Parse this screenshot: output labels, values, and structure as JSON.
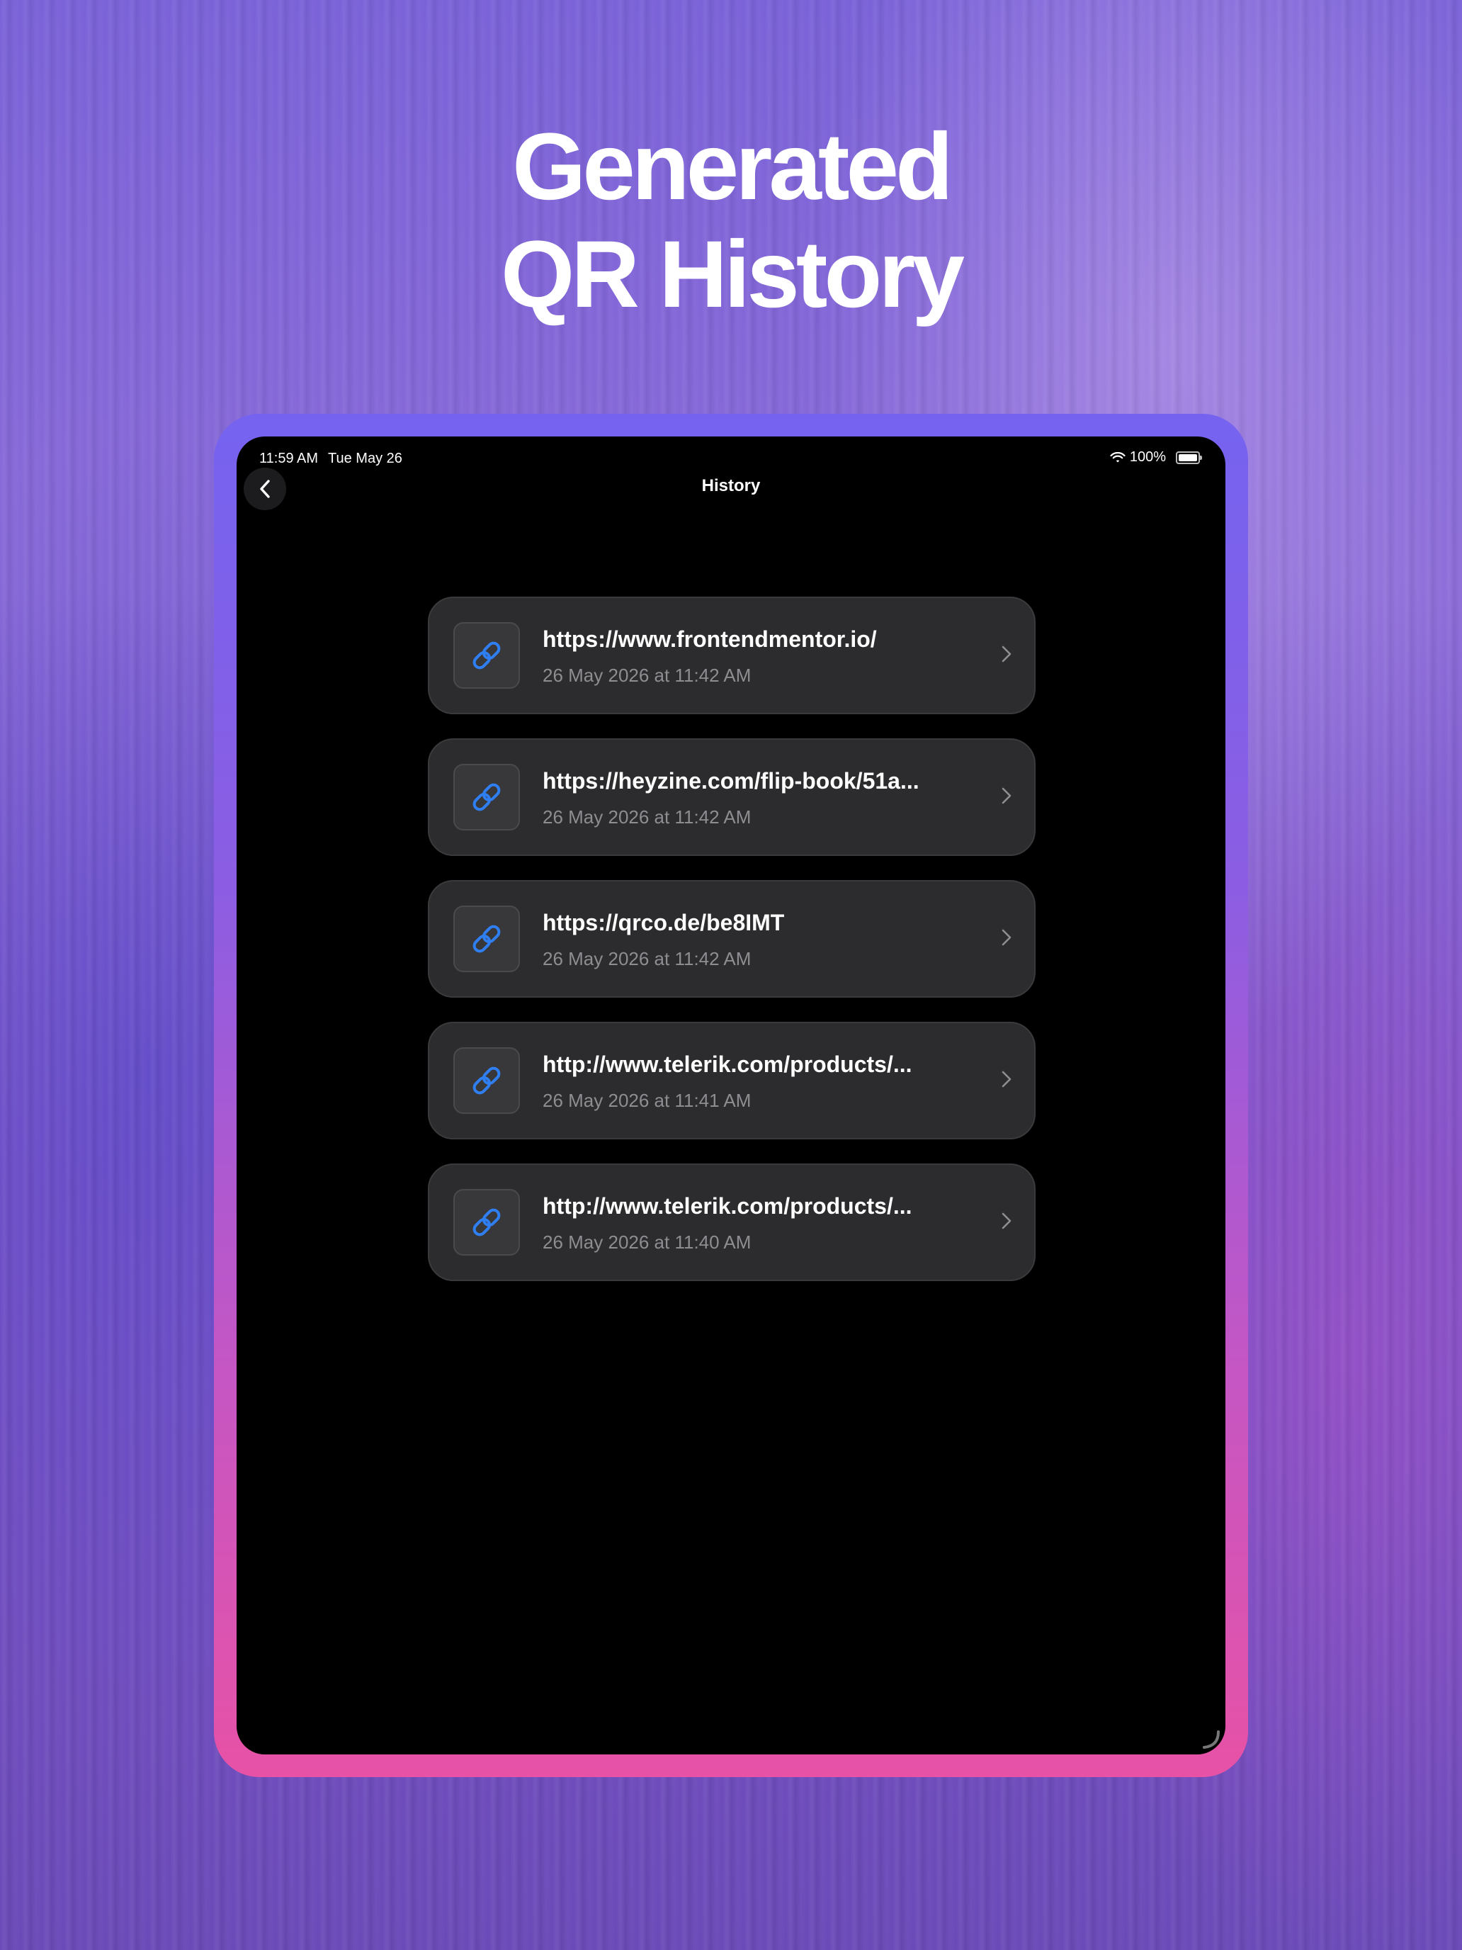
{
  "hero": {
    "line1": "Generated",
    "line2": "QR History"
  },
  "status_bar": {
    "time": "11:59 AM",
    "date": "Tue May 26",
    "battery": "100%"
  },
  "nav": {
    "title": "History"
  },
  "history": [
    {
      "title": "https://www.frontendmentor.io/",
      "date": "26 May 2026 at 11:42 AM",
      "icon": "link-icon"
    },
    {
      "title": "https://heyzine.com/flip-book/51a...",
      "date": "26 May 2026 at 11:42 AM",
      "icon": "link-icon"
    },
    {
      "title": "https://qrco.de/be8IMT",
      "date": "26 May 2026 at 11:42 AM",
      "icon": "link-icon"
    },
    {
      "title": "http://www.telerik.com/products/...",
      "date": "26 May 2026 at 11:41 AM",
      "icon": "link-icon"
    },
    {
      "title": "http://www.telerik.com/products/...",
      "date": "26 May 2026 at 11:40 AM",
      "icon": "link-icon"
    }
  ],
  "colors": {
    "accent_link": "#2f7ff2",
    "card_bg": "#2c2c2e",
    "secondary_text": "#8d8d92",
    "frame_top": "#7563f0",
    "frame_bottom": "#e752a6"
  }
}
